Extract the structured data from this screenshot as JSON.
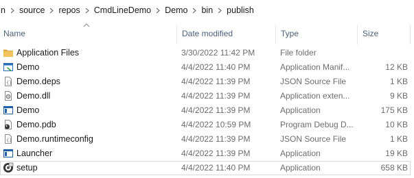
{
  "breadcrumb": [
    "n",
    "source",
    "repos",
    "CmdLineDemo",
    "Demo",
    "bin",
    "publish"
  ],
  "columns": {
    "name": "Name",
    "date": "Date modified",
    "type": "Type",
    "size": "Size"
  },
  "files": [
    {
      "name": "Application Files",
      "date": "3/30/2022 11:42 PM",
      "type": "File folder",
      "size": "",
      "icon": "folder-icon"
    },
    {
      "name": "Demo",
      "date": "4/4/2022 11:40 PM",
      "type": "Application Manif...",
      "size": "12 KB",
      "icon": "manifest-icon"
    },
    {
      "name": "Demo.deps",
      "date": "4/4/2022 11:39 PM",
      "type": "JSON Source File",
      "size": "1 KB",
      "icon": "json-file-icon"
    },
    {
      "name": "Demo.dll",
      "date": "4/4/2022 11:39 PM",
      "type": "Application exten...",
      "size": "9 KB",
      "icon": "dll-icon"
    },
    {
      "name": "Demo",
      "date": "4/4/2022 11:39 PM",
      "type": "Application",
      "size": "175 KB",
      "icon": "application-icon"
    },
    {
      "name": "Demo.pdb",
      "date": "4/4/2022 10:59 PM",
      "type": "Program Debug D...",
      "size": "10 KB",
      "icon": "pdb-icon"
    },
    {
      "name": "Demo.runtimeconfig",
      "date": "4/4/2022 11:39 PM",
      "type": "JSON Source File",
      "size": "1 KB",
      "icon": "json-file-icon"
    },
    {
      "name": "Launcher",
      "date": "4/4/2022 11:39 PM",
      "type": "Application",
      "size": "19 KB",
      "icon": "application-icon"
    },
    {
      "name": "setup",
      "date": "4/4/2022 11:40 PM",
      "type": "Application",
      "size": "658 KB",
      "icon": "setup-icon",
      "selected": true
    }
  ],
  "colors": {
    "header_text": "#4c607a",
    "detail_text": "#6d6d6d",
    "folder": "#e8b94a"
  }
}
